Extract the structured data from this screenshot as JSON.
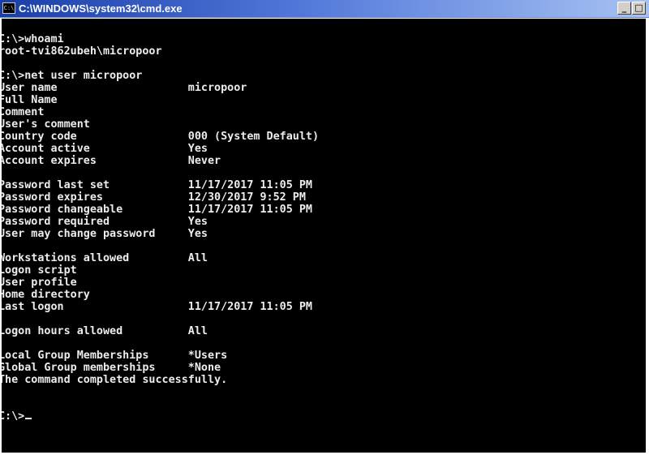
{
  "window": {
    "title": "C:\\WINDOWS\\system32\\cmd.exe",
    "icon_label": "C:\\",
    "icon_name": "cmd-console-icon",
    "minimize_glyph": "_",
    "maximize_glyph": "□"
  },
  "console": {
    "lines": [
      "C:\\>whoami",
      "root-tvi862ubeh\\micropoor",
      "",
      "C:\\>net user micropoor",
      "User name                    micropoor",
      "Full Name",
      "Comment",
      "User's comment",
      "Country code                 000 (System Default)",
      "Account active               Yes",
      "Account expires              Never",
      "",
      "Password last set            11/17/2017 11:05 PM",
      "Password expires             12/30/2017 9:52 PM",
      "Password changeable          11/17/2017 11:05 PM",
      "Password required            Yes",
      "User may change password     Yes",
      "",
      "Workstations allowed         All",
      "Logon script",
      "User profile",
      "Home directory",
      "Last logon                   11/17/2017 11:05 PM",
      "",
      "Logon hours allowed          All",
      "",
      "Local Group Memberships      *Users",
      "Global Group memberships     *None",
      "The command completed successfully.",
      "",
      ""
    ],
    "prompt": "C:\\>"
  }
}
